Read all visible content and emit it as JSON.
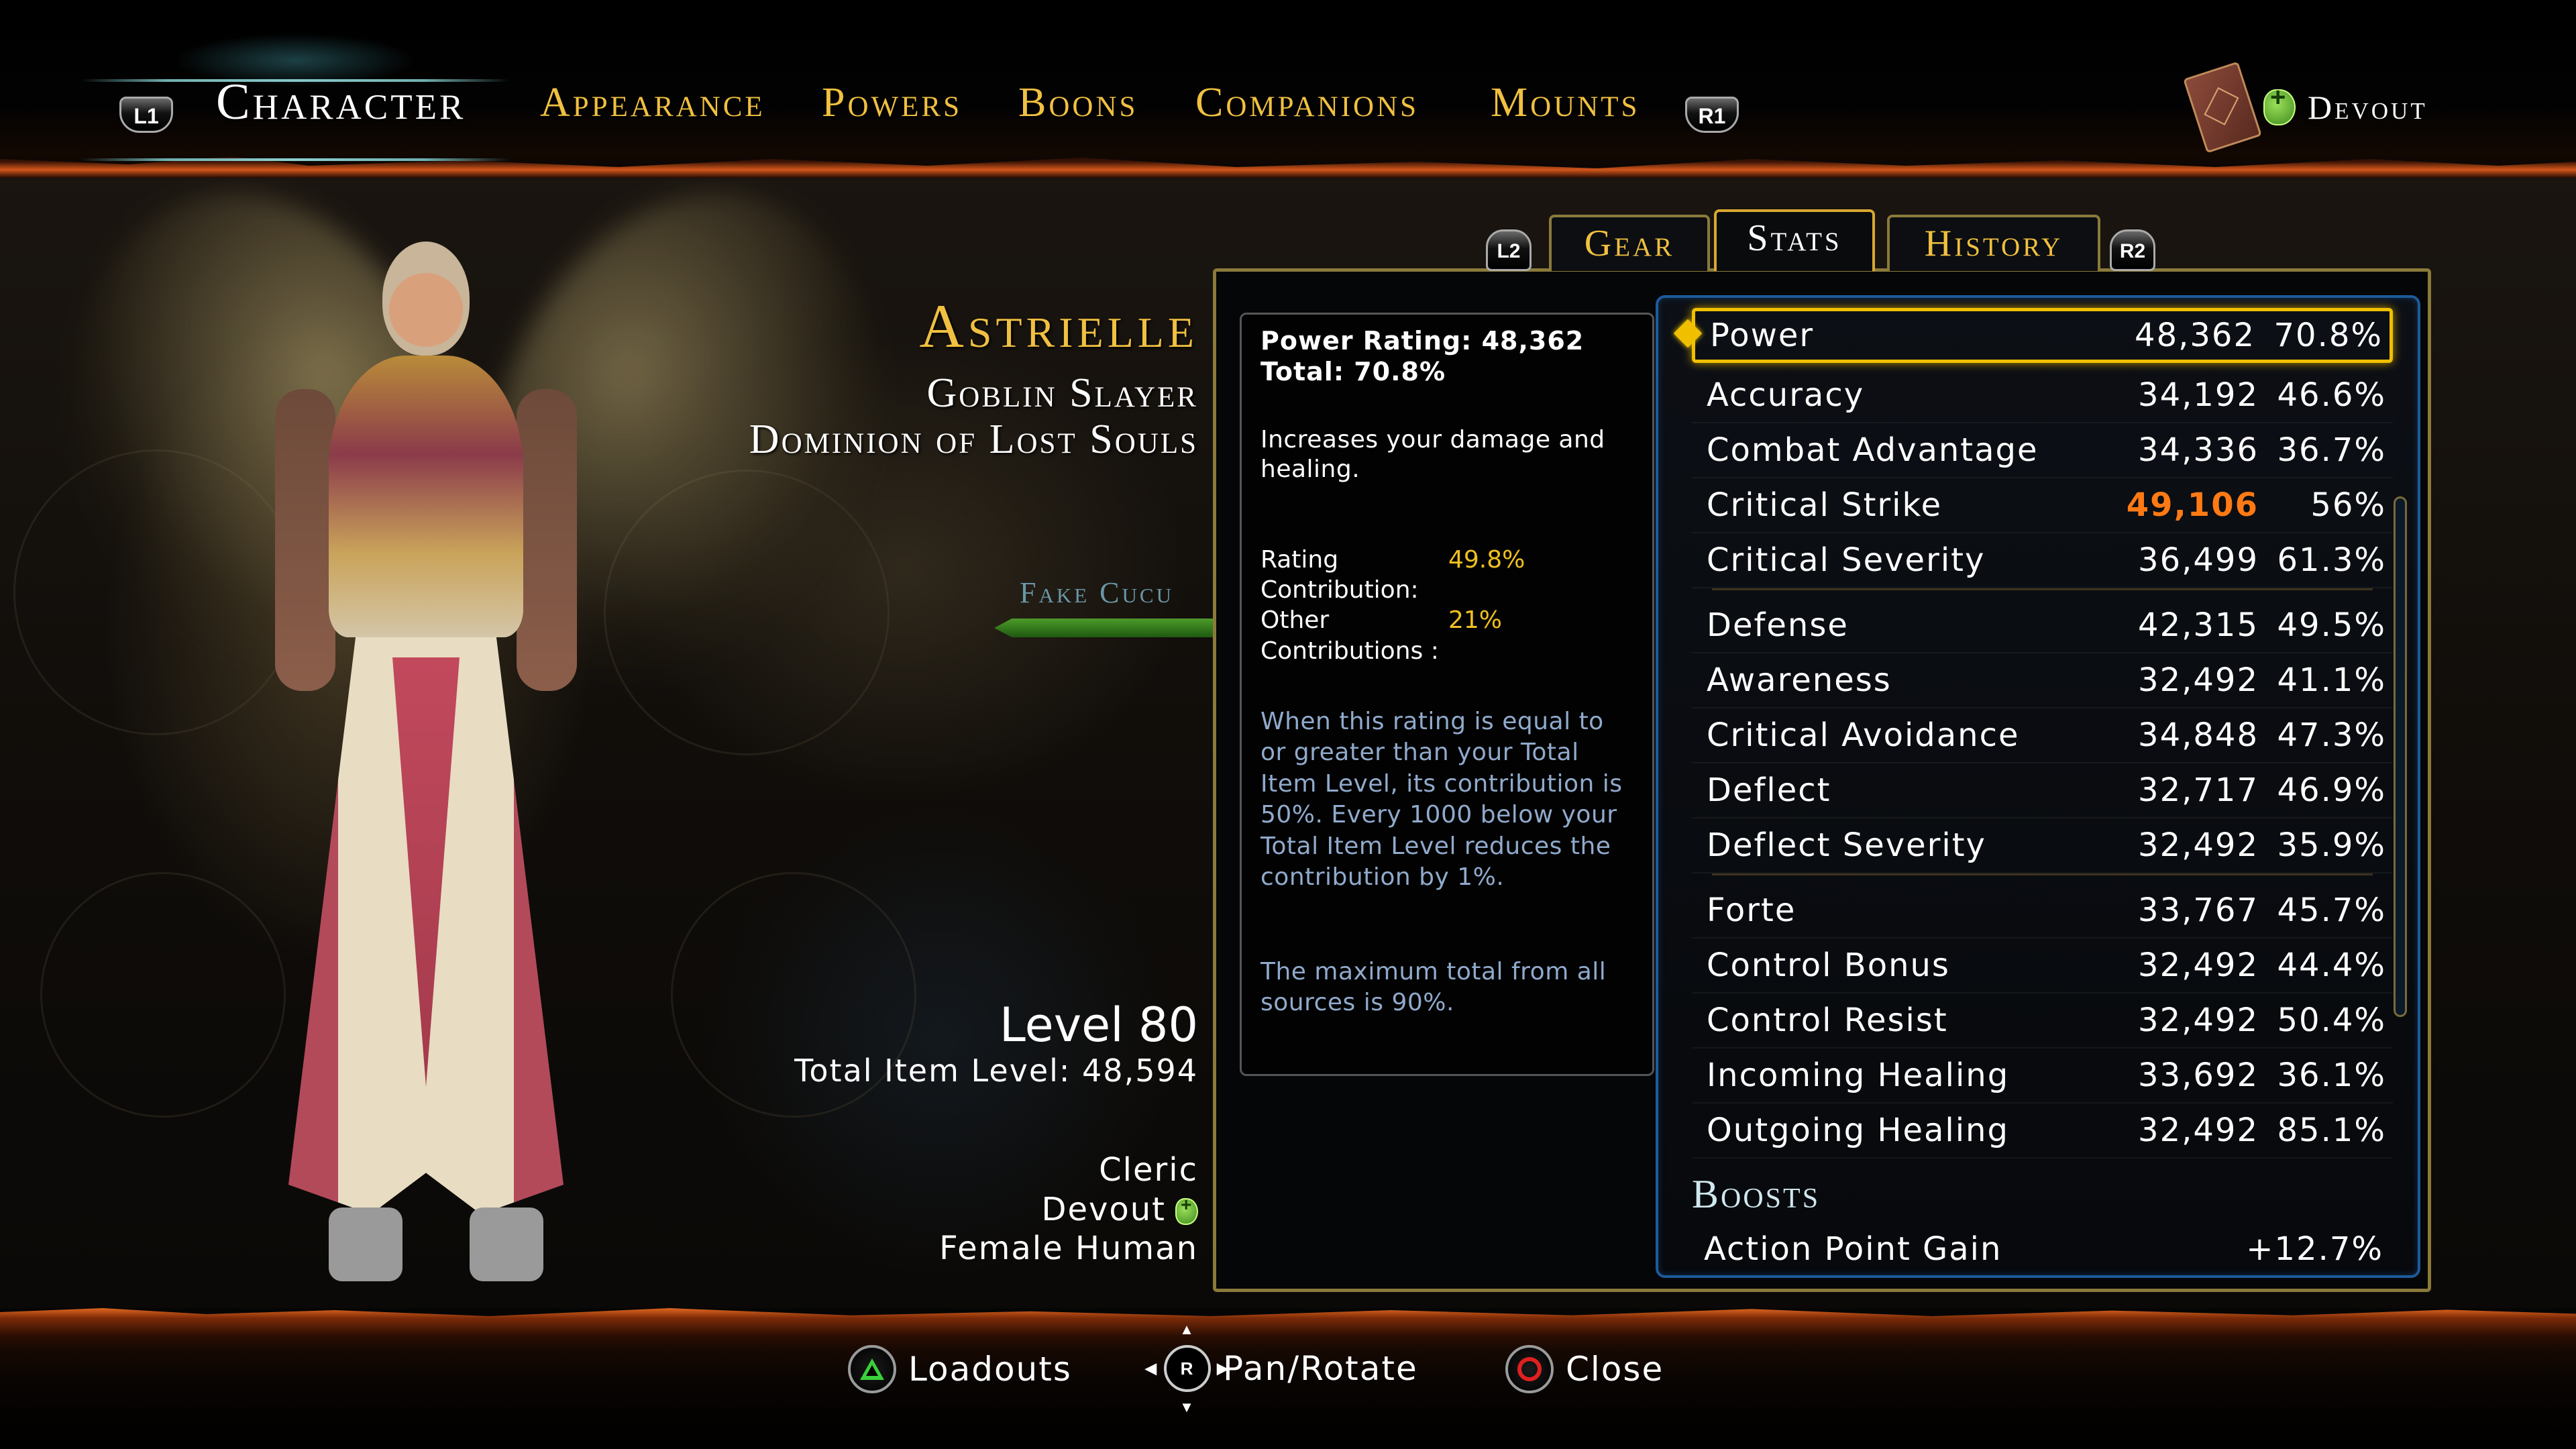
{
  "nav": {
    "left_bumper": "L1",
    "right_bumper": "R1",
    "tabs": [
      {
        "label": "Character",
        "active": true
      },
      {
        "label": "Appearance",
        "active": false
      },
      {
        "label": "Powers",
        "active": false
      },
      {
        "label": "Boons",
        "active": false
      },
      {
        "label": "Companions",
        "active": false
      },
      {
        "label": "Mounts",
        "active": false
      }
    ],
    "paragon_label": "Devout"
  },
  "character": {
    "name": "Astrielle",
    "title": "Goblin Slayer",
    "guild": "Dominion of Lost Souls",
    "level": "Level 80",
    "item_level": "Total Item Level: 48,594",
    "class": "Cleric",
    "paragon": "Devout",
    "race": "Female Human"
  },
  "scene": {
    "nameplate": "Fake Cucu"
  },
  "subtabs": {
    "left_trigger": "L2",
    "right_trigger": "R2",
    "items": [
      {
        "label": "Gear",
        "active": false
      },
      {
        "label": "Stats",
        "active": true
      },
      {
        "label": "History",
        "active": false
      }
    ]
  },
  "tooltip": {
    "line1": "Power Rating: 48,362",
    "line2": "Total: 70.8%",
    "description": "Increases your damage and healing.",
    "rating_contribution_label": "Rating Contribution:",
    "rating_contribution_value": "49.8%",
    "other_contributions_label": "Other Contributions :",
    "other_contributions_value": "21%",
    "note": "When this rating is equal to or greater than your Total Item Level, its contribution is 50%. Every 1000 below your Total Item Level reduces the contribution by 1%.",
    "max_note": "The maximum total from all sources is 90%."
  },
  "stats": {
    "groups": [
      [
        {
          "name": "Power",
          "rating": "48,362",
          "pct": "70.8%",
          "selected": true
        },
        {
          "name": "Accuracy",
          "rating": "34,192",
          "pct": "46.6%"
        },
        {
          "name": "Combat Advantage",
          "rating": "34,336",
          "pct": "36.7%"
        },
        {
          "name": "Critical Strike",
          "rating": "49,106",
          "pct": "56%",
          "over_cap": true
        },
        {
          "name": "Critical Severity",
          "rating": "36,499",
          "pct": "61.3%"
        }
      ],
      [
        {
          "name": "Defense",
          "rating": "42,315",
          "pct": "49.5%"
        },
        {
          "name": "Awareness",
          "rating": "32,492",
          "pct": "41.1%"
        },
        {
          "name": "Critical Avoidance",
          "rating": "34,848",
          "pct": "47.3%"
        },
        {
          "name": "Deflect",
          "rating": "32,717",
          "pct": "46.9%"
        },
        {
          "name": "Deflect Severity",
          "rating": "32,492",
          "pct": "35.9%"
        }
      ],
      [
        {
          "name": "Forte",
          "rating": "33,767",
          "pct": "45.7%"
        },
        {
          "name": "Control Bonus",
          "rating": "32,492",
          "pct": "44.4%"
        },
        {
          "name": "Control Resist",
          "rating": "32,492",
          "pct": "50.4%"
        },
        {
          "name": "Incoming Healing",
          "rating": "33,692",
          "pct": "36.1%"
        },
        {
          "name": "Outgoing Healing",
          "rating": "32,492",
          "pct": "85.1%"
        }
      ]
    ],
    "boosts_title": "Boosts",
    "boosts": [
      {
        "name": "Action Point Gain",
        "value": "+12.7%"
      }
    ],
    "highlight_color": "#f0c000",
    "over_cap_color": "#ff7a14"
  },
  "footer": {
    "loadouts": "Loadouts",
    "pan_rotate": "Pan/Rotate",
    "rstick_label": "R",
    "close": "Close"
  }
}
